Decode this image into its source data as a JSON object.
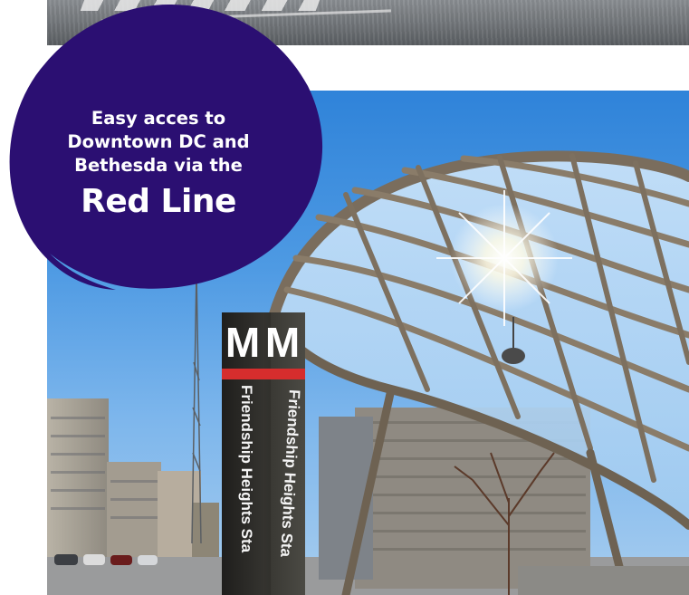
{
  "hero": {
    "headline_lines": [
      "Easy acces to",
      "Downtown DC and",
      "Bethesda via the"
    ],
    "headline_emphasis": "Red Line"
  },
  "signage": {
    "logo_letter": "M",
    "station_name": "Friendship Heights Sta"
  },
  "colors": {
    "bubble_purple": "#2b0f72",
    "metro_red": "#d62d2d",
    "sky_blue": "#2f83d9"
  }
}
